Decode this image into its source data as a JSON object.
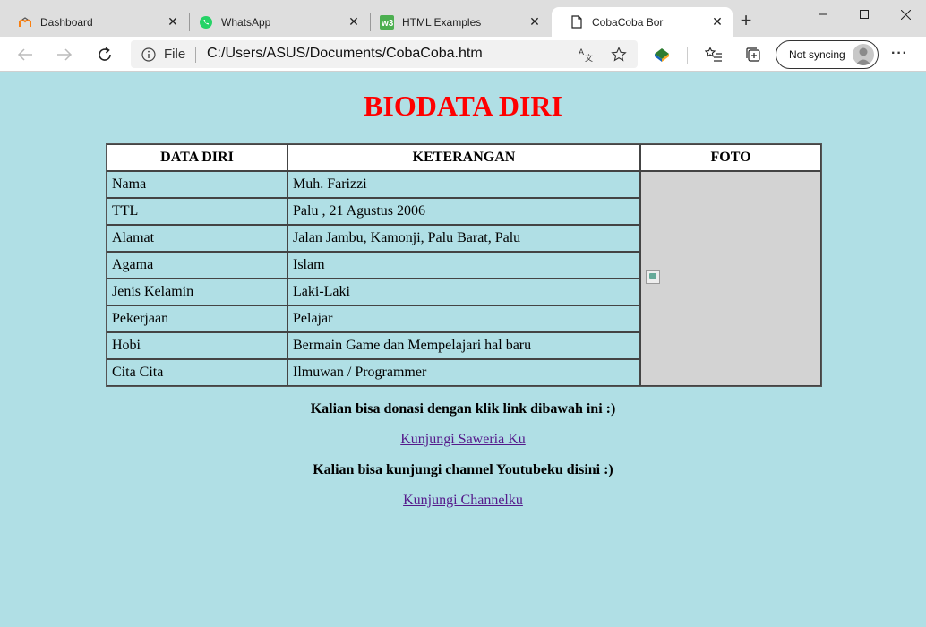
{
  "browser": {
    "tabs": [
      {
        "title": "Dashboard",
        "icon": "moodle-icon"
      },
      {
        "title": "WhatsApp",
        "icon": "whatsapp-icon"
      },
      {
        "title": "HTML Examples",
        "icon": "w3schools-icon"
      },
      {
        "title": "CobaCoba Bor",
        "icon": "page-icon",
        "active": true
      }
    ],
    "address": {
      "scheme_label": "File",
      "url": "C:/Users/ASUS/Documents/CobaCoba.htm"
    },
    "sync_label": "Not syncing"
  },
  "page": {
    "title": "BIODATA DIRI",
    "title_color": "#ff0000",
    "background": "#b0dfe5",
    "table": {
      "headers": [
        "DATA DIRI",
        "KETERANGAN",
        "FOTO"
      ],
      "rows": [
        [
          "Nama",
          "Muh. Farizzi"
        ],
        [
          "TTL",
          "Palu , 21 Agustus 2006"
        ],
        [
          "Alamat",
          "Jalan Jambu, Kamonji, Palu Barat, Palu"
        ],
        [
          "Agama",
          "Islam"
        ],
        [
          "Jenis Kelamin",
          "Laki-Laki"
        ],
        [
          "Pekerjaan",
          "Pelajar"
        ],
        [
          "Hobi",
          "Bermain Game dan Mempelajari hal baru"
        ],
        [
          "Cita Cita",
          "Ilmuwan / Programmer"
        ]
      ]
    },
    "donate_text": "Kalian bisa donasi dengan klik link dibawah ini :)",
    "donate_link": "Kunjungi Saweria Ku",
    "youtube_text": "Kalian bisa kunjungi channel Youtubeku disini :)",
    "youtube_link": "Kunjungi Channelku"
  }
}
